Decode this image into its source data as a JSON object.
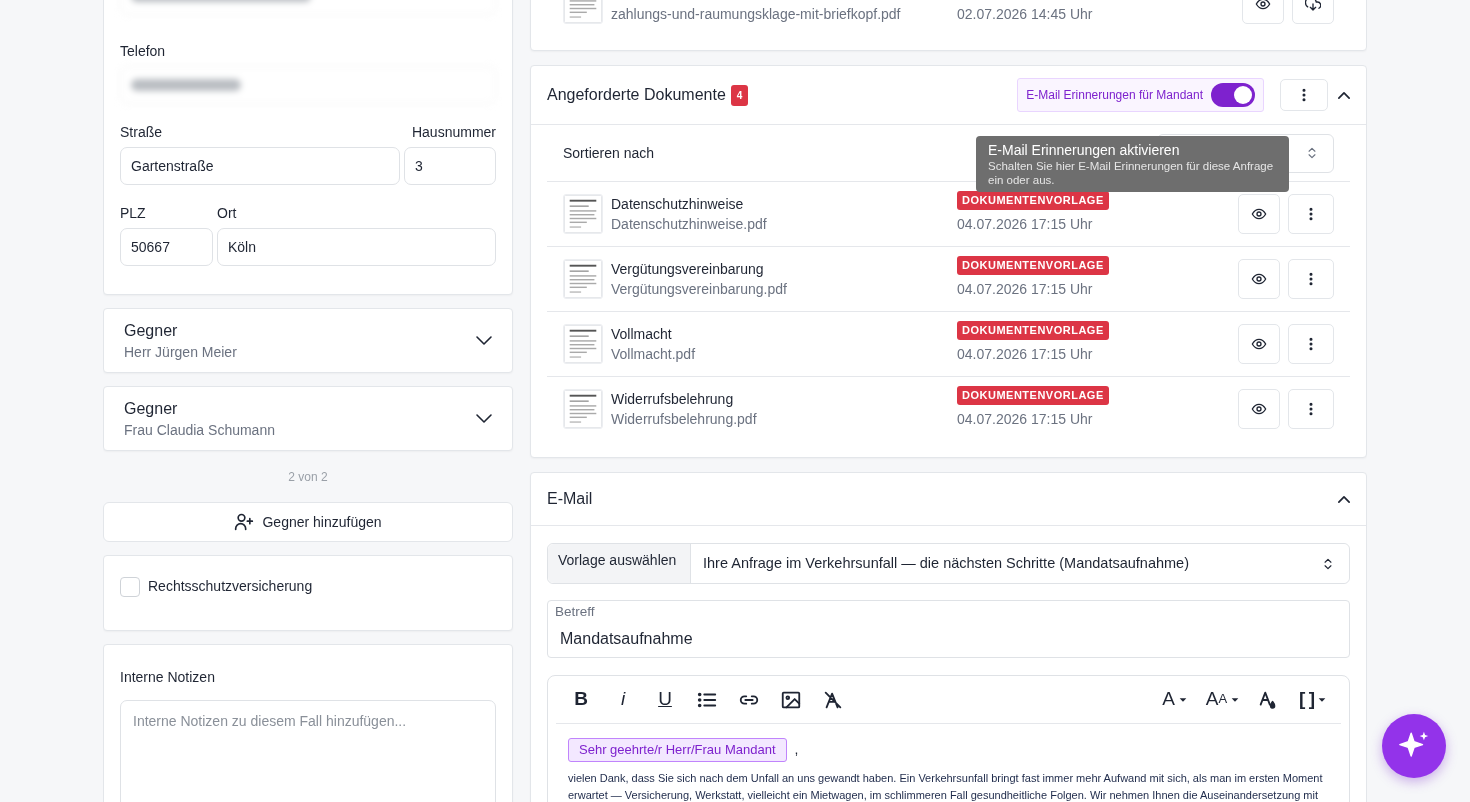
{
  "contact": {
    "phone_label": "Telefon",
    "street_label": "Straße",
    "street": "Gartenstraße",
    "house_number_label": "Hausnummer",
    "house_number": "3",
    "zip_label": "PLZ",
    "zip": "50667",
    "city_label": "Ort",
    "city": "Köln"
  },
  "opponents": [
    {
      "title": "Gegner",
      "name": "Herr Jürgen Meier",
      "expanded": false
    },
    {
      "title": "Gegner",
      "name": "Frau Claudia Schumann",
      "expanded": false
    }
  ],
  "opponent_count": "2 von 2",
  "add_opponent_button": "Gegner hinzufügen",
  "insurance": {
    "label": "Rechtsschutzversicherung",
    "checked": false
  },
  "notes": {
    "label": "Interne Notizen",
    "placeholder": "Interne Notizen zu diesem Fall hinzufügen..."
  },
  "previous_document": {
    "file": "zahlungs-und-raumungsklage-mit-briefkopf.pdf",
    "date": "02.07.2026 14:45 Uhr"
  },
  "requested_documents": {
    "title": "Angeforderte Dokumente",
    "count": "4",
    "reminder_label": "E-Mail Erinnerungen für Mandant",
    "reminder_on": true,
    "expanded": true,
    "sort_label": "Sortieren nach",
    "tooltip": {
      "title": "E-Mail Erinnerungen aktivieren",
      "text": "Schalten Sie hier E-Mail Erinnerungen für diese Anfrage ein oder aus."
    },
    "rows": [
      {
        "title": "Datenschutzhinweise",
        "file": "Datenschutzhinweise.pdf",
        "tag": "DOKUMENTENVORLAGE",
        "date": "04.07.2026 17:15 Uhr"
      },
      {
        "title": "Vergütungsvereinbarung",
        "file": "Vergütungsvereinbarung.pdf",
        "tag": "DOKUMENTENVORLAGE",
        "date": "04.07.2026 17:15 Uhr"
      },
      {
        "title": "Vollmacht",
        "file": "Vollmacht.pdf",
        "tag": "DOKUMENTENVORLAGE",
        "date": "04.07.2026 17:15 Uhr"
      },
      {
        "title": "Widerrufsbelehrung",
        "file": "Widerrufsbelehrung.pdf",
        "tag": "DOKUMENTENVORLAGE",
        "date": "04.07.2026 17:15 Uhr"
      }
    ]
  },
  "email": {
    "title": "E-Mail",
    "expanded": true,
    "template_label": "Vorlage auswählen",
    "template": "Ihre Anfrage im Verkehrsunfall — die nächsten Schritte (Mandatsaufnahme)",
    "subject_label": "Betreff",
    "subject": "Mandatsaufnahme",
    "toolbar_left": [
      {
        "kind": "bold",
        "glyph": "B"
      },
      {
        "kind": "italic",
        "glyph": "i"
      },
      {
        "kind": "underline",
        "glyph": "U"
      },
      {
        "kind": "list"
      },
      {
        "kind": "link"
      },
      {
        "kind": "image"
      },
      {
        "kind": "clear"
      }
    ],
    "toolbar_right": [
      {
        "kind": "font",
        "glyph": "A"
      },
      {
        "kind": "size",
        "glyph": "A",
        "small_glyph": "A"
      },
      {
        "kind": "color"
      },
      {
        "kind": "placeholder",
        "glyph": "[ ]"
      }
    ],
    "salutation_chip": "Sehr geehrte/r Herr/Frau Mandant",
    "salutation_end": ",",
    "body": "vielen Dank, dass Sie sich nach dem Unfall an uns gewandt haben. Ein Verkehrsunfall bringt fast immer mehr Aufwand mit sich, als man im ersten Moment erwartet — Versicherung, Werkstatt, vielleicht ein Mietwagen, im schlimmeren Fall gesundheitliche Folgen. Wir nehmen Ihnen die Auseinandersetzung mit"
  }
}
